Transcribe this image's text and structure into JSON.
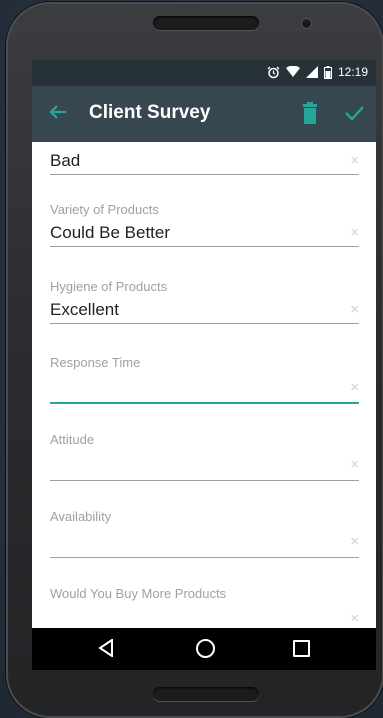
{
  "status": {
    "time": "12:19",
    "icons": [
      "alarm-icon",
      "wifi-icon",
      "signal-icon",
      "battery-icon"
    ]
  },
  "appbar": {
    "title": "Client Survey",
    "accent": "#26a69a",
    "background": "#37474f"
  },
  "form": {
    "fields": [
      {
        "label": "",
        "value": "Bad"
      },
      {
        "label": "Variety of Products",
        "value": "Could Be Better"
      },
      {
        "label": "Hygiene of Products",
        "value": "Excellent"
      },
      {
        "label": "Response Time",
        "value": "",
        "focused": true
      },
      {
        "label": "Attitude",
        "value": ""
      },
      {
        "label": "Availability",
        "value": ""
      },
      {
        "label": "Would You Buy More Products",
        "value": ""
      }
    ],
    "clear_symbol": "×"
  },
  "navbar": {
    "buttons": [
      "back",
      "home",
      "recents"
    ]
  }
}
